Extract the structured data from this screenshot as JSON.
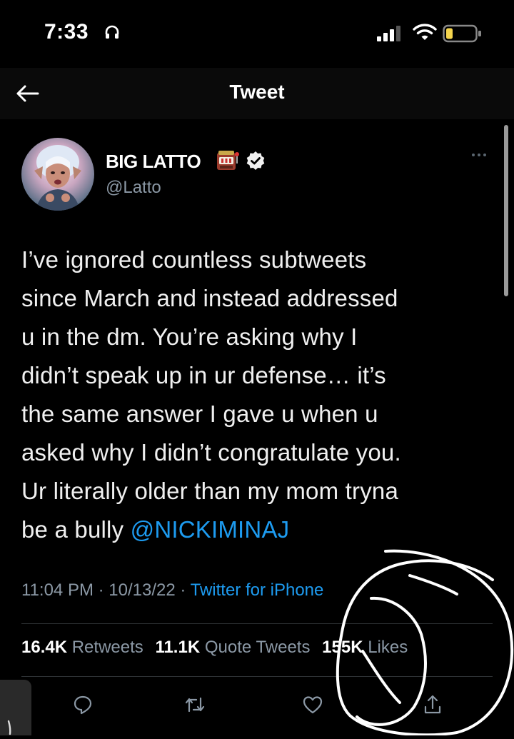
{
  "status_bar": {
    "time": "7:33"
  },
  "nav": {
    "title": "Tweet"
  },
  "tweet": {
    "display_name": "BIG LATTO",
    "handle": "@Latto",
    "text_lines": [
      "I’ve ignored countless subtweets",
      "since March and instead addressed",
      "u in the dm. You’re asking why I",
      "didn’t speak up in ur defense… it’s",
      "the same answer I gave u when u",
      "asked why I didn’t congratulate you.",
      "Ur literally older than my mom tryna",
      "be a bully "
    ],
    "mention": "@NICKIMINAJ",
    "time": "11:04 PM",
    "date": "10/13/22",
    "source": "Twitter for iPhone",
    "separator": " · "
  },
  "stats": {
    "retweets_count": "16.4K",
    "retweets_label": "Retweets",
    "quotes_count": "11.1K",
    "quotes_label": "Quote Tweets",
    "likes_count": "155K",
    "likes_label": "Likes"
  },
  "icons": {
    "headphone": "headphones-icon",
    "signal": "cellular-signal-icon",
    "wifi": "wifi-icon",
    "battery": "battery-low-icon",
    "back": "arrow-left-icon",
    "slot": "slot-machine-icon",
    "verified": "verified-badge-icon",
    "more": "more-horizontal-icon",
    "reply": "speech-bubble-icon",
    "retweet": "retweet-icon",
    "like": "heart-icon",
    "share": "share-icon"
  },
  "colors": {
    "accent": "#1d9bf0",
    "background": "#000000",
    "battery_fill": "#f4d44d",
    "annotation_stroke": "#ffffff"
  }
}
